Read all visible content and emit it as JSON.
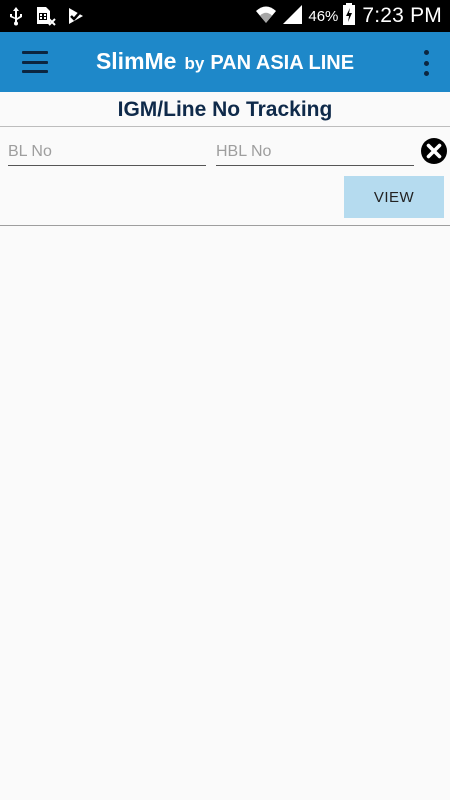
{
  "status_bar": {
    "icons_left": [
      "usb-icon",
      "sim-card-icon",
      "download-check-icon"
    ],
    "icons_right": [
      "wifi-icon",
      "signal-icon",
      "battery-icon"
    ],
    "battery_percent": "46%",
    "time": "7:23 PM"
  },
  "app_bar": {
    "title": "SlimMe",
    "by": "by",
    "brand": "PAN ASIA LINE",
    "accent_color": "#1e88c9"
  },
  "page": {
    "title": "IGM/Line No Tracking"
  },
  "form": {
    "bl_placeholder": "BL No",
    "bl_value": "",
    "hbl_placeholder": "HBL No",
    "hbl_value": "",
    "view_label": "VIEW",
    "view_button_color": "#b5dbef"
  }
}
